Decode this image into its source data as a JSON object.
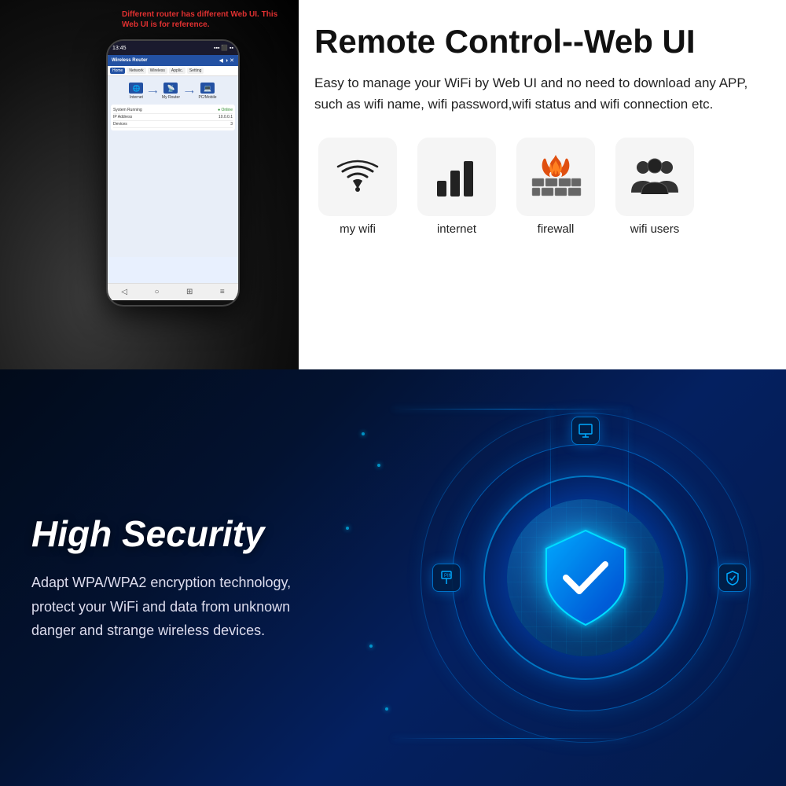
{
  "top": {
    "reference_note": "Different router has different Web UI. This Web UI is for reference.",
    "title": "Remote Control--Web UI",
    "description": "Easy to manage your WiFi by Web UI and no need to download any APP, such as wifi name, wifi password,wifi status and wifi connection etc.",
    "features": [
      {
        "id": "my-wifi",
        "label": "my wifi",
        "icon": "📶"
      },
      {
        "id": "internet",
        "label": "internet",
        "icon": "📊"
      },
      {
        "id": "firewall",
        "label": "firewall",
        "icon": "🔥"
      },
      {
        "id": "wifi-users",
        "label": "wifi users",
        "icon": "👥"
      }
    ],
    "phone": {
      "time": "13:45",
      "app_title": "Wireless Router",
      "nav_items": [
        "Home",
        "Network",
        "Wireless",
        "Applications",
        "Setting"
      ],
      "status_label": "System Running",
      "ip_label": "IP Address"
    }
  },
  "bottom": {
    "title": "High Security",
    "description": "Adapt WPA/WPA2 encryption technology, protect your WiFi and data from unknown danger and strange wireless devices.",
    "orbit_icons": [
      {
        "id": "top-icon",
        "icon": "🖥"
      },
      {
        "id": "left-icon",
        "icon": "📌"
      },
      {
        "id": "right-icon",
        "icon": "🛡"
      }
    ]
  },
  "colors": {
    "accent_blue": "#0066ff",
    "dark_bg": "#020b1a",
    "text_white": "#ffffff",
    "red_note": "#e03030"
  }
}
